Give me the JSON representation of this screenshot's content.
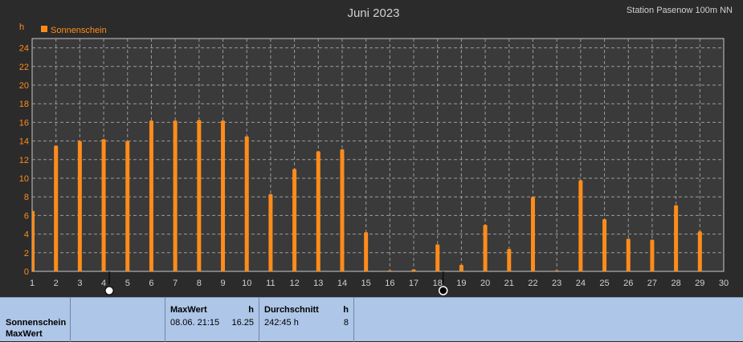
{
  "chart_data": {
    "type": "bar",
    "title": "Juni 2023",
    "station": "Station Pasenow 100m NN",
    "ylabel": "h",
    "legend": {
      "label": "Sonnenschein",
      "color": "#ff8c1a",
      "placement": "top-left"
    },
    "ylim": [
      0,
      25
    ],
    "yticks": [
      0,
      2,
      4,
      6,
      8,
      10,
      12,
      14,
      16,
      18,
      20,
      22,
      24
    ],
    "xticks": [
      1,
      2,
      3,
      4,
      5,
      6,
      7,
      8,
      9,
      10,
      11,
      12,
      13,
      14,
      15,
      16,
      17,
      18,
      19,
      20,
      21,
      22,
      23,
      24,
      25,
      26,
      27,
      28,
      29,
      30
    ],
    "grid": true,
    "series": [
      {
        "name": "Sonnenschein",
        "color": "#ff8c1a",
        "x": [
          1,
          2,
          3,
          4,
          5,
          6,
          7,
          8,
          9,
          10,
          11,
          12,
          13,
          14,
          15,
          16,
          17,
          18,
          19,
          20,
          21,
          22,
          23,
          24,
          25,
          26,
          27,
          28,
          29
        ],
        "values": [
          6.5,
          13.5,
          14.0,
          14.2,
          14.0,
          16.2,
          16.2,
          16.25,
          16.2,
          14.5,
          8.3,
          11.0,
          12.9,
          13.1,
          4.2,
          0.1,
          0.2,
          2.9,
          0.7,
          5.0,
          2.4,
          8.0,
          0.1,
          9.8,
          5.6,
          3.5,
          3.4,
          7.1,
          4.3
        ]
      }
    ],
    "moon_phases": [
      {
        "day": 4,
        "icon": "full-moon-icon"
      },
      {
        "day": 18,
        "icon": "new-moon-icon"
      }
    ]
  },
  "info": {
    "row_label_1": "Sonnenschein",
    "row_label_2": "MaxWert",
    "max_header": "MaxWert",
    "max_unit": "h",
    "max_date": "08.06. 21:15",
    "max_value": "16.25",
    "avg_header": "Durchschnitt",
    "avg_unit": "h",
    "avg_total": "242:45 h",
    "avg_value": "8"
  },
  "colors": {
    "background": "#2b2b2b",
    "bar": "#ff8c1a",
    "axis_text": "#ff8c1a",
    "panel": "#aec6e8"
  }
}
